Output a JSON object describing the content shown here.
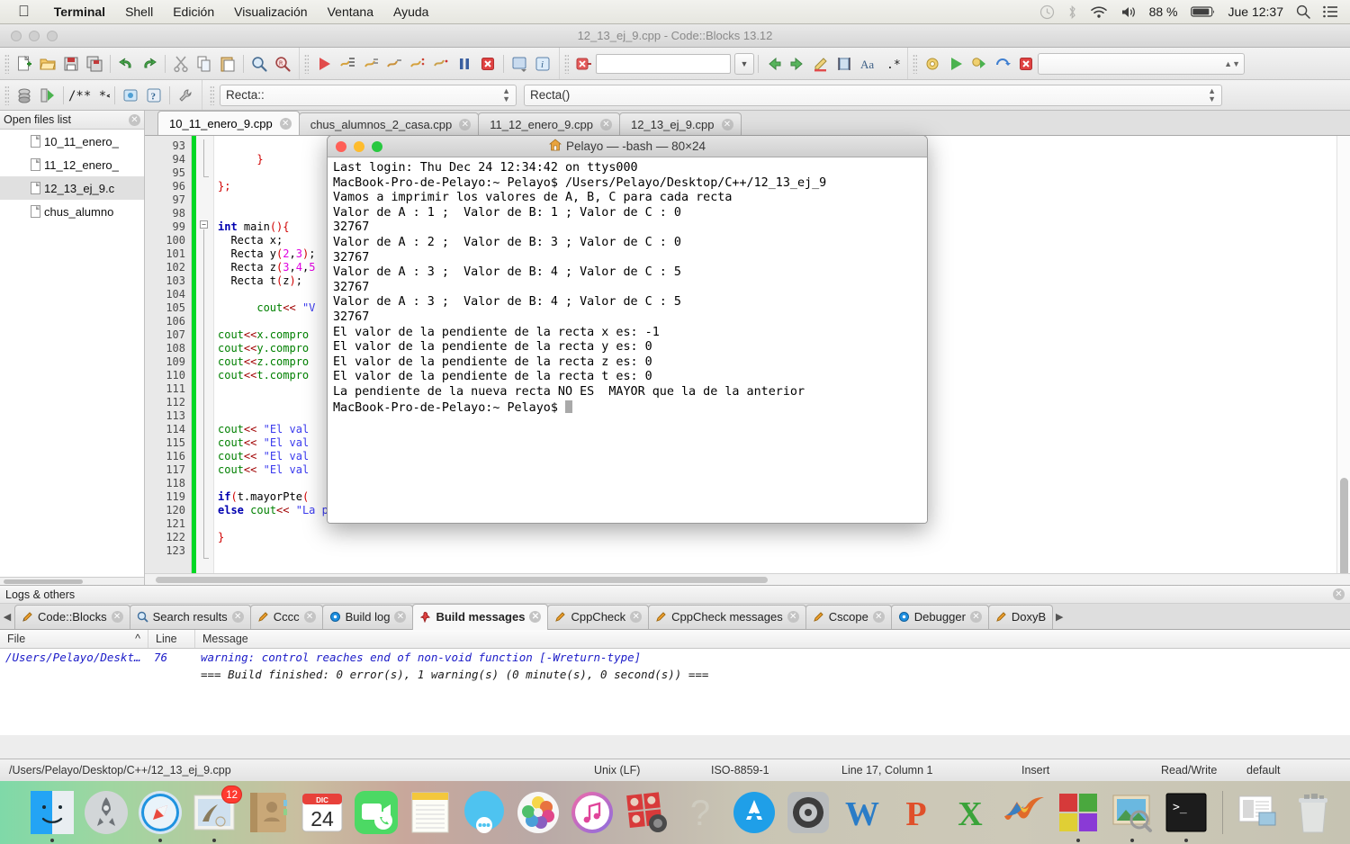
{
  "menubar": {
    "apple": "apple-logo",
    "items": [
      {
        "label": "Terminal",
        "bold": true
      },
      {
        "label": "Shell",
        "bold": false
      },
      {
        "label": "Edición",
        "bold": false
      },
      {
        "label": "Visualización",
        "bold": false
      },
      {
        "label": "Ventana",
        "bold": false
      },
      {
        "label": "Ayuda",
        "bold": false
      }
    ],
    "status": {
      "battery_percent": "88 %",
      "clock": "Jue 12:37",
      "icons": [
        "timemachine-icon",
        "bluetooth-icon",
        "wifi-icon",
        "volume-icon",
        "battery-icon",
        "search-icon",
        "notification-center-icon"
      ]
    }
  },
  "codeblocks": {
    "window_title": "12_13_ej_9.cpp - Code::Blocks 13.12",
    "toolbar": {
      "main_icons": [
        "new-file-icon",
        "open-file-icon",
        "save-icon",
        "save-all-icon",
        "undo-icon",
        "redo-icon",
        "cut-icon",
        "copy-icon",
        "paste-icon",
        "find-icon",
        "replace-icon"
      ],
      "build_icons": [
        "build-icon",
        "run-icon",
        "build-and-run-icon",
        "rebuild-icon",
        "abort-icon",
        "next-error-icon",
        "previous-error-icon",
        "pause-icon",
        "stop-icon",
        "select-target-icon",
        "info-icon"
      ],
      "search_value": "",
      "nav_icons": [
        "back-icon",
        "forward-icon",
        "highlight-icon",
        "match-case-icon",
        "whole-word-icon",
        "regex-icon"
      ],
      "debug_icons": [
        "debug-settings-icon",
        "debug-run-icon",
        "debug-continue-icon",
        "debug-step-icon",
        "debug-stop-icon"
      ],
      "debug_target_value": ""
    },
    "symbolbar": {
      "scope_value": "Recta::",
      "function_value": "Recta()",
      "doc_icons": [
        "class-browser-icon",
        "goto-declaration-icon",
        "comment-icon",
        "doxyblocks-icon",
        "help-icon",
        "settings-icon"
      ]
    },
    "open_files": {
      "title": "Open files list",
      "items": [
        {
          "label": "10_11_enero_",
          "selected": false
        },
        {
          "label": "11_12_enero_",
          "selected": false
        },
        {
          "label": "12_13_ej_9.c",
          "selected": true
        },
        {
          "label": "chus_alumno",
          "selected": false
        }
      ]
    },
    "editor_tabs": [
      {
        "label": "10_11_enero_9.cpp",
        "active": true
      },
      {
        "label": "chus_alumnos_2_casa.cpp",
        "active": false
      },
      {
        "label": "11_12_enero_9.cpp",
        "active": false
      },
      {
        "label": "12_13_ej_9.cpp",
        "active": false
      }
    ],
    "code": {
      "first_line": 93,
      "lines": [
        {
          "n": 93,
          "html": ""
        },
        {
          "n": 94,
          "html": "      <span class='p'>}</span>"
        },
        {
          "n": 95,
          "html": ""
        },
        {
          "n": 96,
          "html": "<span class='p'>};</span>"
        },
        {
          "n": 97,
          "html": ""
        },
        {
          "n": 98,
          "html": ""
        },
        {
          "n": 99,
          "html": "<span class='k'>int</span> main<span class='p'>()</span><span class='p'>{</span>"
        },
        {
          "n": 100,
          "html": "  Recta x;"
        },
        {
          "n": 101,
          "html": "  Recta y<span class='p'>(</span><span class='n'>2</span>,<span class='n'>3</span><span class='p'>)</span>;"
        },
        {
          "n": 102,
          "html": "  Recta z<span class='p'>(</span><span class='n'>3</span>,<span class='n'>4</span>,<span class='n'>5</span>"
        },
        {
          "n": 103,
          "html": "  Recta t<span class='p'>(</span>z<span class='p'>)</span>;"
        },
        {
          "n": 104,
          "html": ""
        },
        {
          "n": 105,
          "html": "      <span class='c'>cout</span><span class='op'>&lt;&lt;</span> <span class='s'>\"V</span>"
        },
        {
          "n": 106,
          "html": ""
        },
        {
          "n": 107,
          "html": "<span class='c'>cout</span><span class='op'>&lt;&lt;</span><span class='c'>x.compro</span>"
        },
        {
          "n": 108,
          "html": "<span class='c'>cout</span><span class='op'>&lt;&lt;</span><span class='c'>y.compro</span>"
        },
        {
          "n": 109,
          "html": "<span class='c'>cout</span><span class='op'>&lt;&lt;</span><span class='c'>z.compro</span>"
        },
        {
          "n": 110,
          "html": "<span class='c'>cout</span><span class='op'>&lt;&lt;</span><span class='c'>t.compro</span>"
        },
        {
          "n": 111,
          "html": ""
        },
        {
          "n": 112,
          "html": ""
        },
        {
          "n": 113,
          "html": ""
        },
        {
          "n": 114,
          "html": "<span class='c'>cout</span><span class='op'>&lt;&lt;</span> <span class='s'>\"El val</span>"
        },
        {
          "n": 115,
          "html": "<span class='c'>cout</span><span class='op'>&lt;&lt;</span> <span class='s'>\"El val</span>"
        },
        {
          "n": 116,
          "html": "<span class='c'>cout</span><span class='op'>&lt;&lt;</span> <span class='s'>\"El val</span>"
        },
        {
          "n": 117,
          "html": "<span class='c'>cout</span><span class='op'>&lt;&lt;</span> <span class='s'>\"El val</span>"
        },
        {
          "n": 118,
          "html": ""
        },
        {
          "n": 119,
          "html": "<span class='k'>if</span><span class='p'>(</span>t.mayorPte<span class='p'>(</span>"
        },
        {
          "n": 120,
          "html": "<span class='k'>else</span> <span class='c'>cout</span><span class='op'>&lt;&lt;</span> <span class='s'>\"La pendiente de la nueva recta NO ES  MAYOR que la de la anterior\"</span><span class='op'>&lt;&lt;</span><span class='c'>endl</span><span class='p'>;</span>"
        },
        {
          "n": 121,
          "html": ""
        },
        {
          "n": 122,
          "html": "<span class='p'>}</span>"
        },
        {
          "n": 123,
          "html": ""
        }
      ]
    },
    "logs": {
      "title": "Logs & others",
      "tabs": [
        {
          "label": "Code::Blocks",
          "icon": "pencil-icon",
          "active": false
        },
        {
          "label": "Search results",
          "icon": "magnifier-icon",
          "active": false
        },
        {
          "label": "Cccc",
          "icon": "pencil-icon",
          "active": false
        },
        {
          "label": "Build log",
          "icon": "gear-blue-icon",
          "active": false
        },
        {
          "label": "Build messages",
          "icon": "pin-icon",
          "active": true
        },
        {
          "label": "CppCheck",
          "icon": "pencil-icon",
          "active": false
        },
        {
          "label": "CppCheck messages",
          "icon": "pencil-icon",
          "active": false
        },
        {
          "label": "Cscope",
          "icon": "pencil-icon",
          "active": false
        },
        {
          "label": "Debugger",
          "icon": "gear-blue-icon",
          "active": false
        },
        {
          "label": "DoxyB",
          "icon": "pencil-icon",
          "active": false
        }
      ],
      "columns": [
        "File",
        "Line",
        "Message"
      ],
      "rows": [
        {
          "file": "/Users/Pelayo/Deskt…",
          "line": "76",
          "message": "warning: control reaches end of non-void function [-Wreturn-type]",
          "style": "warn"
        },
        {
          "file": "",
          "line": "",
          "message": "=== Build finished: 0 error(s), 1 warning(s) (0 minute(s), 0 second(s)) ===",
          "style": "plain"
        }
      ]
    },
    "statusbar": {
      "path": "/Users/Pelayo/Desktop/C++/12_13_ej_9.cpp",
      "eol": "Unix (LF)",
      "encoding": "ISO-8859-1",
      "caret": "Line 17, Column 1",
      "mode": "Insert",
      "access": "Read/Write",
      "profile": "default"
    }
  },
  "terminal": {
    "title": "Pelayo — -bash — 80×24",
    "title_icon": "home-folder-icon",
    "lines": [
      "Last login: Thu Dec 24 12:34:42 on ttys000",
      "MacBook-Pro-de-Pelayo:~ Pelayo$ /Users/Pelayo/Desktop/C++/12_13_ej_9",
      "Vamos a imprimir los valores de A, B, C para cada recta",
      "Valor de A : 1 ;  Valor de B: 1 ; Valor de C : 0",
      "32767",
      "Valor de A : 2 ;  Valor de B: 3 ; Valor de C : 0",
      "32767",
      "Valor de A : 3 ;  Valor de B: 4 ; Valor de C : 5",
      "32767",
      "Valor de A : 3 ;  Valor de B: 4 ; Valor de C : 5",
      "32767",
      "El valor de la pendiente de la recta x es: -1",
      "El valor de la pendiente de la recta y es: 0",
      "El valor de la pendiente de la recta z es: 0",
      "El valor de la pendiente de la recta t es: 0",
      "La pendiente de la nueva recta NO ES  MAYOR que la de la anterior"
    ],
    "prompt": "MacBook-Pro-de-Pelayo:~ Pelayo$ "
  },
  "dock": {
    "items": [
      {
        "name": "finder",
        "running": true
      },
      {
        "name": "launchpad",
        "running": false
      },
      {
        "name": "safari",
        "running": true
      },
      {
        "name": "mail",
        "running": true,
        "badge": "12"
      },
      {
        "name": "contacts",
        "running": false
      },
      {
        "name": "calendar",
        "running": false,
        "month": "DIC",
        "day": "24"
      },
      {
        "name": "facetime",
        "running": false
      },
      {
        "name": "notes",
        "running": false
      },
      {
        "name": "messages",
        "running": false
      },
      {
        "name": "photos",
        "running": false
      },
      {
        "name": "itunes",
        "running": false
      },
      {
        "name": "photo-booth",
        "running": false
      },
      {
        "name": "help",
        "running": false
      },
      {
        "name": "app-store",
        "running": false
      },
      {
        "name": "system-preferences",
        "running": false
      },
      {
        "name": "word",
        "running": false
      },
      {
        "name": "powerpoint",
        "running": false
      },
      {
        "name": "excel",
        "running": false
      },
      {
        "name": "matlab",
        "running": false
      },
      {
        "name": "codeblocks",
        "running": true
      },
      {
        "name": "preview",
        "running": true
      },
      {
        "name": "terminal",
        "running": true
      },
      {
        "name": "documents-stack",
        "running": false
      },
      {
        "name": "trash",
        "running": false
      }
    ]
  }
}
